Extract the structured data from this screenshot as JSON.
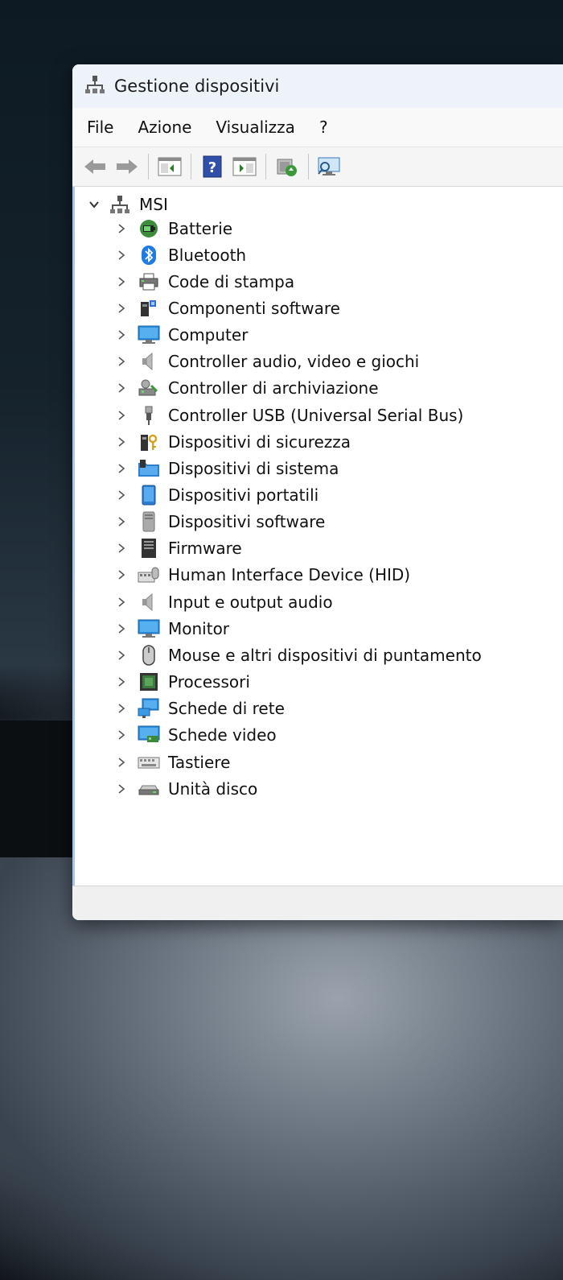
{
  "window": {
    "title": "Gestione dispositivi"
  },
  "menu": [
    {
      "label": "File"
    },
    {
      "label": "Azione"
    },
    {
      "label": "Visualizza"
    },
    {
      "label": "?"
    }
  ],
  "toolbar": [
    "back-icon",
    "forward-icon",
    "properties-panel-icon",
    "help-icon",
    "action-panel-icon",
    "update-driver-icon",
    "scan-hardware-icon"
  ],
  "tree": {
    "root": "MSI",
    "items": [
      {
        "label": "Batterie",
        "icon": "battery-icon"
      },
      {
        "label": "Bluetooth",
        "icon": "bluetooth-icon"
      },
      {
        "label": "Code di stampa",
        "icon": "printer-icon"
      },
      {
        "label": "Componenti software",
        "icon": "software-component-icon"
      },
      {
        "label": "Computer",
        "icon": "computer-icon"
      },
      {
        "label": "Controller audio, video e giochi",
        "icon": "speaker-icon"
      },
      {
        "label": "Controller di archiviazione",
        "icon": "storage-controller-icon"
      },
      {
        "label": "Controller USB (Universal Serial Bus)",
        "icon": "usb-icon"
      },
      {
        "label": "Dispositivi di sicurezza",
        "icon": "security-key-icon"
      },
      {
        "label": "Dispositivi di sistema",
        "icon": "system-folder-icon"
      },
      {
        "label": "Dispositivi portatili",
        "icon": "portable-device-icon"
      },
      {
        "label": "Dispositivi software",
        "icon": "software-device-icon"
      },
      {
        "label": "Firmware",
        "icon": "firmware-icon"
      },
      {
        "label": "Human Interface Device (HID)",
        "icon": "hid-icon"
      },
      {
        "label": "Input e output audio",
        "icon": "audio-io-icon"
      },
      {
        "label": "Monitor",
        "icon": "monitor-icon"
      },
      {
        "label": "Mouse e altri dispositivi di puntamento",
        "icon": "mouse-icon"
      },
      {
        "label": "Processori",
        "icon": "processor-icon"
      },
      {
        "label": "Schede di rete",
        "icon": "network-adapter-icon"
      },
      {
        "label": "Schede video",
        "icon": "display-adapter-icon"
      },
      {
        "label": "Tastiere",
        "icon": "keyboard-icon"
      },
      {
        "label": "Unità disco",
        "icon": "disk-drive-icon"
      }
    ]
  }
}
